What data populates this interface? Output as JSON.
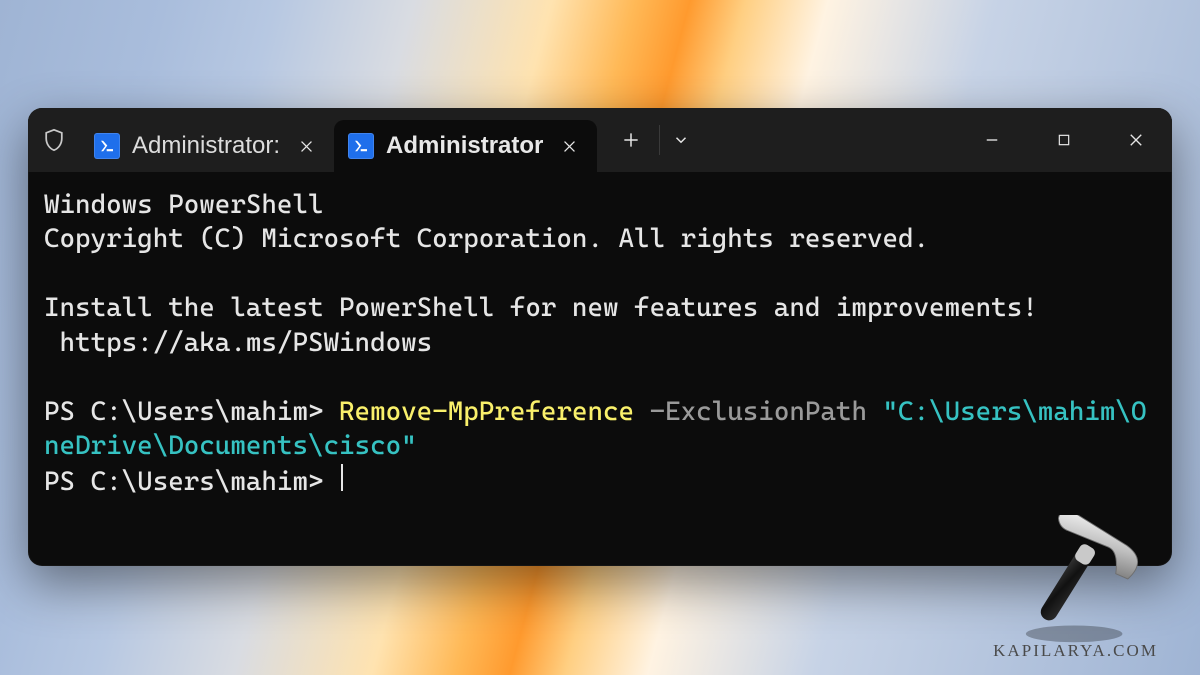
{
  "window": {
    "tabs": [
      {
        "label": "Administrator:",
        "active": false
      },
      {
        "label": "Administrator",
        "active": true
      }
    ]
  },
  "terminal": {
    "banner_line1": "Windows PowerShell",
    "banner_line2": "Copyright (C) Microsoft Corporation. All rights reserved.",
    "tip_line1": "Install the latest PowerShell for new features and improvements!",
    "tip_line2": " https://aka.ms/PSWindows",
    "prompt1_prefix": "PS C:\\Users\\mahim> ",
    "cmd_cmdlet": "Remove-MpPreference",
    "cmd_space1": " ",
    "cmd_param": "-ExclusionPath",
    "cmd_space2": " ",
    "cmd_value": "\"C:\\Users\\mahim\\OneDrive\\Documents\\cisco\"",
    "prompt2_prefix": "PS C:\\Users\\mahim> "
  },
  "watermark": {
    "text": "KAPILARYA.COM"
  },
  "colors": {
    "bg": "#0c0c0c",
    "titlebar": "#1e1e1e",
    "ps_icon": "#1f6feb",
    "cmdlet": "#f9f06b",
    "param": "#9a9a9a",
    "string": "#36c2c2"
  }
}
